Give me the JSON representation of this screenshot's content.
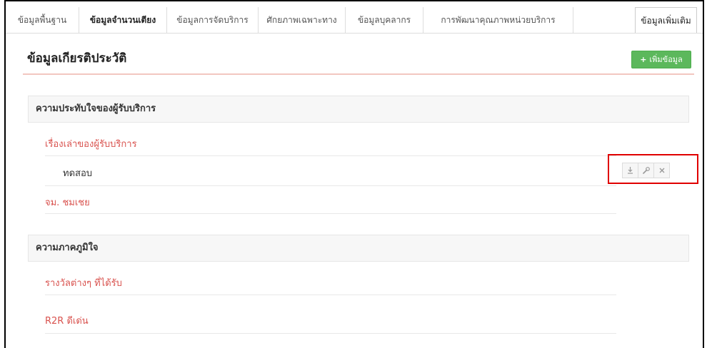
{
  "tabs": [
    {
      "label": "ข้อมูลพื้นฐาน",
      "active": false
    },
    {
      "label": "ข้อมูลจำนวนเตียง",
      "active": true
    },
    {
      "label": "ข้อมูลการจัดบริการ",
      "active": false
    },
    {
      "label": "ศักยภาพเฉพาะทาง",
      "active": false
    },
    {
      "label": "ข้อมูลบุคลากร",
      "active": false
    },
    {
      "label": "การพัฒนาคุณภาพหน่วยบริการ",
      "active": false
    }
  ],
  "more_tab": "ข้อมูลเพิ่มเติม",
  "page_title": "ข้อมูลเกียรติประวัติ",
  "add_button": {
    "icon": "+",
    "label": "เพิ่มข้อมูล"
  },
  "colors": {
    "accent_green": "#5cb85c",
    "link_red": "#d9534f",
    "highlight": "#e00000"
  },
  "sections": [
    {
      "title": "ความประทับใจของผู้รับบริการ",
      "items": [
        {
          "label": "เรื่องเล่าของผู้รับบริการ",
          "entries": [
            {
              "text": "ทดสอบ",
              "actions": [
                "download-icon",
                "wrench-icon",
                "close-icon"
              ]
            }
          ]
        },
        {
          "label": "จม. ชมเชย"
        }
      ]
    },
    {
      "title": "ความภาคภูมิใจ",
      "items": [
        {
          "label": "รางวัลต่างๆ ที่ได้รับ"
        },
        {
          "label": "R2R ดีเด่น"
        }
      ]
    }
  ]
}
